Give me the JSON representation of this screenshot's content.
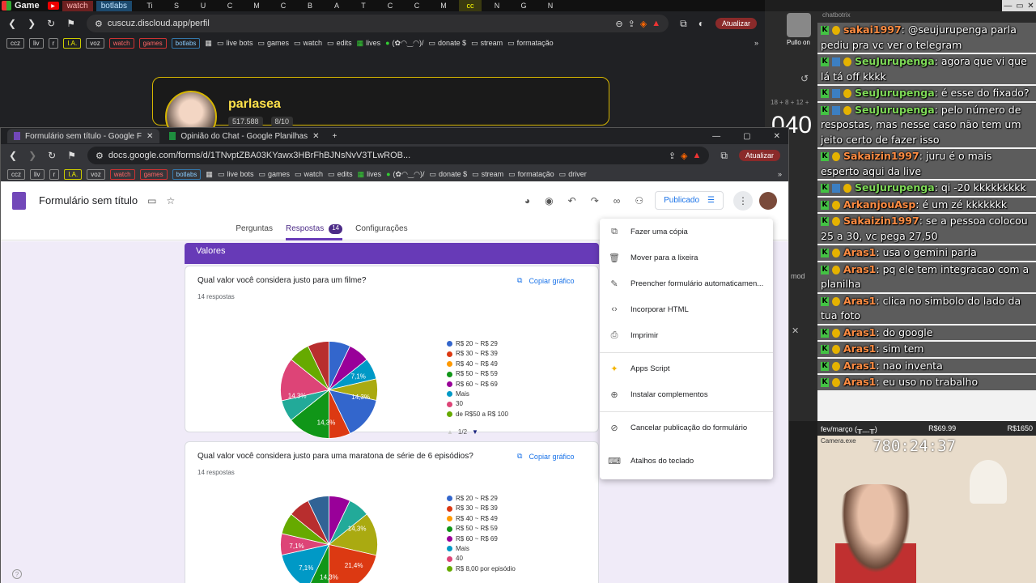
{
  "taskbar": {
    "title": "Game",
    "tabs": [
      "watch",
      "botlabs"
    ],
    "window_controls": [
      "—",
      "▭",
      "✕"
    ]
  },
  "bg_browser": {
    "pinned_tabs": [
      "Ti",
      "S",
      "U",
      "C",
      "M",
      "C",
      "B",
      "A",
      "T",
      "C",
      "C",
      "M",
      "cc",
      "N",
      "G",
      "N"
    ],
    "url": "cuscuz.discloud.app/perfil",
    "update_label": "Atualizar",
    "profile": {
      "name": "parlasea",
      "stat1": "517.588",
      "stat2": "8/10"
    }
  },
  "bookmarks": {
    "chips": [
      "ccz",
      "liv",
      "r",
      "I.A.",
      "voz",
      "watch",
      "games",
      "botlabs"
    ],
    "items": [
      "live bots",
      "games",
      "watch",
      "edits",
      "lives",
      "(✿◠‿◠)/",
      "donate $",
      "stream",
      "formatação"
    ],
    "extra": "driver"
  },
  "forms_window": {
    "tabs": [
      "Formulário sem título - Google F",
      "Opinião do Chat - Google Planilhas"
    ],
    "url": "docs.google.com/forms/d/1TNvptZBA03KYawx3HBrFhBJNsNvV3TLwROB...",
    "update_label": "Atualizar"
  },
  "form": {
    "title": "Formulário sem título",
    "publish_label": "Publicado",
    "tabs": {
      "questions": "Perguntas",
      "responses": "Respostas",
      "responses_count": "14",
      "settings": "Configurações"
    },
    "section_title": "Valores",
    "copy_chart": "Copiar gráfico",
    "q1": {
      "title": "Qual valor você considera justo para um filme?",
      "count": "14 respostas",
      "pager": "1/2"
    },
    "q2": {
      "title": "Qual valor você considera justo para uma maratona de série de 6 episódios?",
      "count": "14 respostas"
    }
  },
  "chart_data": [
    {
      "type": "pie",
      "title": "Qual valor você considera justo para um filme?",
      "labels": [
        "R$ 20 ~ R$ 29",
        "R$ 30 ~ R$ 39",
        "R$ 40 ~ R$ 49",
        "R$ 50 ~ R$ 59",
        "R$ 60 ~ R$ 69",
        "Mais",
        "30",
        "de R$50 a R$ 100"
      ],
      "values": [
        7.1,
        7.1,
        7.1,
        7.1,
        7.1,
        0,
        0,
        0
      ],
      "slices": [
        {
          "value": 7.1,
          "color": "#3366cc"
        },
        {
          "value": 7.1,
          "color": "#990099"
        },
        {
          "value": 7.1,
          "color": "#0099c6"
        },
        {
          "value": 7.1,
          "color": "#aaaa11"
        },
        {
          "value": 14.3,
          "color": "#3366cc"
        },
        {
          "value": 7.1,
          "color": "#dc3912"
        },
        {
          "value": 14.3,
          "color": "#109618"
        },
        {
          "value": 7.1,
          "color": "#22aa99"
        },
        {
          "value": 14.3,
          "color": "#dd4477"
        },
        {
          "value": 7.1,
          "color": "#66aa00"
        },
        {
          "value": 7.1,
          "color": "#b82e2e"
        }
      ],
      "data_labels": [
        "7,1%",
        "14,3%",
        "14,3%",
        "14,3%"
      ],
      "legend_colors": [
        "#3366cc",
        "#dc3912",
        "#ff9900",
        "#109618",
        "#990099",
        "#0099c6",
        "#dd4477",
        "#66aa00"
      ]
    },
    {
      "type": "pie",
      "title": "Qual valor você considera justo para uma maratona de série de 6 episódios?",
      "labels": [
        "R$ 20 ~ R$ 29",
        "R$ 30 ~ R$ 39",
        "R$ 40 ~ R$ 49",
        "R$ 50 ~ R$ 59",
        "R$ 60 ~ R$ 69",
        "Mais",
        "40",
        "R$ 8,00 por episódio"
      ],
      "slices": [
        {
          "value": 7.1,
          "color": "#990099"
        },
        {
          "value": 7.1,
          "color": "#22aa99"
        },
        {
          "value": 14.3,
          "color": "#aaaa11"
        },
        {
          "value": 21.4,
          "color": "#dc3912"
        },
        {
          "value": 7.1,
          "color": "#109618"
        },
        {
          "value": 14.3,
          "color": "#0099c6"
        },
        {
          "value": 7.1,
          "color": "#dd4477"
        },
        {
          "value": 7.1,
          "color": "#66aa00"
        },
        {
          "value": 7.1,
          "color": "#b82e2e"
        },
        {
          "value": 7.1,
          "color": "#316395"
        }
      ],
      "data_labels": [
        "14,3%",
        "7,1%",
        "7,1%",
        "21,4%",
        "14,3%"
      ],
      "legend_colors": [
        "#3366cc",
        "#dc3912",
        "#ff9900",
        "#109618",
        "#990099",
        "#0099c6",
        "#dd4477",
        "#66aa00"
      ]
    }
  ],
  "menu": [
    "Fazer uma cópia",
    "Mover para a lixeira",
    "Preencher formulário automaticamen...",
    "Incorporar HTML",
    "Imprimir",
    "Apps Script",
    "Instalar complementos",
    "Cancelar publicação do formulário",
    "Atalhos do teclado"
  ],
  "chat": {
    "header": "chatbotrix",
    "messages": [
      {
        "user": "sakai1997",
        "text": ": @seujurupenga parla pediu pra vc ver o telegram",
        "color": "#ff8c42"
      },
      {
        "user": "SeuJurupenga",
        "text": ": agora que vi que lá tá off kkkk",
        "color": "#7ed957"
      },
      {
        "user": "SeuJurupenga",
        "text": ": é esse do fixado?",
        "color": "#7ed957"
      },
      {
        "user": "SeuJurupenga",
        "text": ": pelo número de respostas, mas nesse caso não tem um jeito certo de fazer isso",
        "color": "#7ed957"
      },
      {
        "user": "Sakaizin1997",
        "text": ": juru é o mais esperto aqui da live",
        "color": "#ff8c42"
      },
      {
        "user": "SeuJurupenga",
        "text": ": qi -20 kkkkkkkkk",
        "color": "#7ed957"
      },
      {
        "user": "ArkanjouAsp",
        "text": ": é um zé kkkkkkk",
        "color": "#ff8c42"
      },
      {
        "user": "Sakaizin1997",
        "text": ": se a pessoa colocou 25 a 30, vc pega 27,50",
        "color": "#ff8c42"
      },
      {
        "user": "Aras1",
        "text": ": usa o gemini parla",
        "color": "#ff8c42"
      },
      {
        "user": "Aras1",
        "text": ": pq ele tem integracao com a planilha",
        "color": "#ff8c42"
      },
      {
        "user": "Aras1",
        "text": ": clica no simbolo do lado da tua foto",
        "color": "#ff8c42"
      },
      {
        "user": "Aras1",
        "text": ": do google",
        "color": "#ff8c42"
      },
      {
        "user": "Aras1",
        "text": ": sim tem",
        "color": "#ff8c42"
      },
      {
        "user": "Aras1",
        "text": ": nao inventa",
        "color": "#ff8c42"
      },
      {
        "user": "Aras1",
        "text": ": eu uso no trabalho",
        "color": "#ff8c42"
      }
    ]
  },
  "side_strip": {
    "big_number": "040",
    "formula": "18 + 8 + 12 +",
    "mod_label": "mod",
    "avatar_label": "Pullo on"
  },
  "camera": {
    "label": "fev/março (╥﹏╥)",
    "money": "R$69.99",
    "goal": "R$1650",
    "timer": "780:24:37",
    "cam_label": "Camera.exe"
  }
}
